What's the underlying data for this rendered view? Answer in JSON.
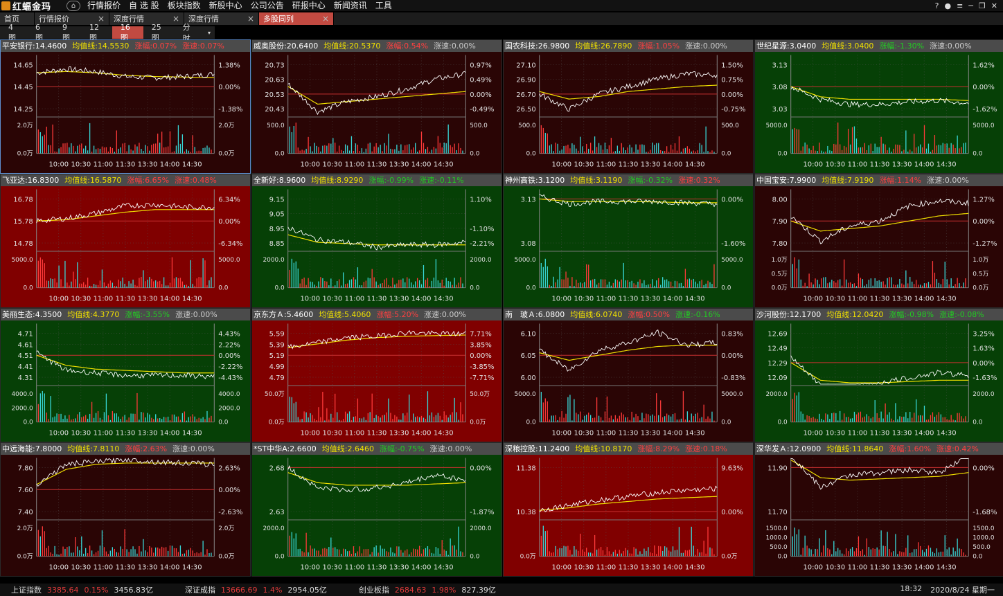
{
  "app": {
    "logo_text": "红蝠金玛"
  },
  "menu": [
    "行情报价",
    "自 选 股",
    "板块指数",
    "新股中心",
    "公司公告",
    "研报中心",
    "新闻资讯",
    "工具"
  ],
  "tabs": [
    {
      "label": "首页",
      "closable": false
    },
    {
      "label": "行情报价",
      "closable": true
    },
    {
      "label": "深度行情",
      "closable": true
    },
    {
      "label": "深度行情",
      "closable": true
    },
    {
      "label": "多股同列",
      "closable": true,
      "active": true
    }
  ],
  "grid_options": [
    "4图",
    "6图",
    "9图",
    "12图",
    "16图",
    "25图",
    "分时"
  ],
  "grid_active": "16图",
  "time_ticks": [
    "10:00",
    "10:30",
    "11:00",
    "11:30",
    "13:30",
    "14:00",
    "14:30"
  ],
  "colors": {
    "red_bg": "#7f0000",
    "dark_red_bg": "#3a0606",
    "green_bg": "#053a05",
    "up": "#ff4040",
    "down": "#22cc22",
    "ma": "#f0e000",
    "price": "#ffffff"
  },
  "stocks": [
    {
      "name": "平安银行",
      "price": "14.4600",
      "ma_label": "均值线:",
      "ma": "14.5530",
      "chg_label": "涨幅:",
      "chg": "0.07%",
      "spd_label": "涨速:",
      "spd": "0.07%",
      "bg": "dark",
      "y_left": [
        "14.65",
        "14.45",
        "14.25"
      ],
      "y_right": [
        "1.38%",
        "0.00%",
        "-1.38%"
      ],
      "vol_left": [
        "2.0万",
        "0.0万"
      ],
      "vol_right": [
        "2.0万",
        "0.0万"
      ],
      "trend": [
        0.55,
        0.7,
        0.6,
        0.4,
        0.35,
        0.4,
        0.5
      ],
      "ma_trend": [
        0.55,
        0.6,
        0.55,
        0.45,
        0.4,
        0.38,
        0.36
      ],
      "chg_color": "up",
      "spd_color": "up",
      "selected": true
    },
    {
      "name": "威奥股份",
      "price": "20.6400",
      "ma_label": "均值线:",
      "ma": "20.5370",
      "chg_label": "涨幅:",
      "chg": "0.54%",
      "spd_label": "涨速:",
      "spd": "0.00%",
      "bg": "dark",
      "y_left": [
        "20.73",
        "20.63",
        "20.53",
        "20.43"
      ],
      "y_right": [
        "0.97%",
        "0.49%",
        "0.00%",
        "-0.49%"
      ],
      "vol_left": [
        "500.0",
        "0.0"
      ],
      "vol_right": [
        "500.0",
        "0.0"
      ],
      "trend": [
        0.4,
        -0.7,
        -0.3,
        -0.1,
        0.2,
        0.6,
        0.8
      ],
      "ma_trend": [
        0.3,
        -0.4,
        -0.3,
        -0.2,
        -0.1,
        0.0,
        0.1
      ],
      "chg_color": "up",
      "spd_color": "neutral"
    },
    {
      "name": "国农科技",
      "price": "26.9800",
      "ma_label": "均值线:",
      "ma": "26.7890",
      "chg_label": "涨幅:",
      "chg": "1.05%",
      "spd_label": "涨速:",
      "spd": "0.00%",
      "bg": "dark",
      "y_left": [
        "27.10",
        "26.90",
        "26.70",
        "26.50"
      ],
      "y_right": [
        "1.50%",
        "0.75%",
        "0.00%",
        "-0.75%"
      ],
      "vol_left": [
        "500.0",
        "0.0"
      ],
      "vol_right": [
        "500.0",
        "0.0"
      ],
      "trend": [
        0.0,
        -0.6,
        0.0,
        0.3,
        0.6,
        0.8,
        0.75
      ],
      "ma_trend": [
        0.1,
        -0.2,
        -0.1,
        0.1,
        0.2,
        0.3,
        0.35
      ],
      "chg_color": "up",
      "spd_color": "neutral"
    },
    {
      "name": "世纪星源",
      "price": "3.0400",
      "ma_label": "均值线:",
      "ma": "3.0400",
      "chg_label": "涨幅:",
      "chg": "-1.30%",
      "spd_label": "涨速:",
      "spd": "0.00%",
      "bg": "green",
      "y_left": [
        "3.13",
        "3.08",
        "3.03"
      ],
      "y_right": [
        "1.62%",
        "0.00%",
        "-1.62%"
      ],
      "vol_left": [
        "5000.0",
        "0.0"
      ],
      "vol_right": [
        "5000.0",
        "0.0"
      ],
      "trend": [
        0.0,
        -0.5,
        -0.7,
        -0.7,
        -0.6,
        -0.55,
        -0.65
      ],
      "ma_trend": [
        0.0,
        -0.4,
        -0.5,
        -0.5,
        -0.5,
        -0.5,
        -0.55
      ],
      "chg_color": "down",
      "spd_color": "neutral"
    },
    {
      "name": "飞亚达",
      "price": "16.8300",
      "ma_label": "均值线:",
      "ma": "16.5870",
      "chg_label": "涨幅:",
      "chg": "6.65%",
      "spd_label": "涨速:",
      "spd": "0.48%",
      "bg": "red",
      "y_left": [
        "16.78",
        "15.78",
        "14.78"
      ],
      "y_right": [
        "6.34%",
        "0.00%",
        "-6.34%"
      ],
      "vol_left": [
        "5000.0",
        "0.0"
      ],
      "vol_right": [
        "5000.0",
        "0.0"
      ],
      "trend": [
        0.0,
        0.1,
        0.3,
        0.6,
        0.65,
        0.55,
        0.55
      ],
      "ma_trend": [
        0.0,
        0.05,
        0.2,
        0.35,
        0.45,
        0.45,
        0.45
      ],
      "chg_color": "up",
      "spd_color": "up"
    },
    {
      "name": "全新好",
      "price": "8.9600",
      "ma_label": "均值线:",
      "ma": "8.9290",
      "chg_label": "涨幅:",
      "chg": "-0.99%",
      "spd_label": "涨速:",
      "spd": "-0.11%",
      "bg": "green",
      "y_left": [
        "9.15",
        "9.05",
        "8.95",
        "8.85"
      ],
      "y_right": [
        "1.10%",
        "",
        "-1.10%",
        "-2.21%"
      ],
      "vol_left": [
        "2000.0",
        "0.0"
      ],
      "vol_right": [
        "2000.0",
        "0.0"
      ],
      "trend": [
        -0.3,
        -0.8,
        -0.9,
        -1.1,
        -1.0,
        -1.0,
        -0.9
      ],
      "ma_trend": [
        -0.6,
        -0.9,
        -0.95,
        -1.0,
        -1.0,
        -1.0,
        -1.0
      ],
      "chg_color": "down",
      "spd_color": "down"
    },
    {
      "name": "神州高铁",
      "price": "3.1200",
      "ma_label": "均值线:",
      "ma": "3.1190",
      "chg_label": "涨幅:",
      "chg": "-0.32%",
      "spd_label": "涨速:",
      "spd": "0.32%",
      "bg": "green",
      "y_left": [
        "3.13",
        "3.08"
      ],
      "y_right": [
        "0.00%",
        "-1.60%"
      ],
      "vol_left": [
        "5000.0",
        "0.0"
      ],
      "vol_right": [
        "5000.0",
        "0.0"
      ],
      "trend": [
        0.1,
        -0.2,
        -0.1,
        -0.1,
        -0.1,
        -0.15,
        -0.2
      ],
      "ma_trend": [
        0.0,
        -0.1,
        -0.1,
        -0.1,
        -0.12,
        -0.15,
        -0.15
      ],
      "chg_color": "down",
      "spd_color": "up"
    },
    {
      "name": "中国宝安",
      "price": "7.9900",
      "ma_label": "均值线:",
      "ma": "7.9190",
      "chg_label": "涨幅:",
      "chg": "1.14%",
      "spd_label": "涨速:",
      "spd": "0.00%",
      "bg": "dark",
      "y_left": [
        "8.00",
        "7.90",
        "7.80"
      ],
      "y_right": [
        "1.27%",
        "0.00%",
        "-1.27%"
      ],
      "vol_left": [
        "1.0万",
        "0.5万",
        "0.0万"
      ],
      "vol_right": [
        "1.0万",
        "0.5万",
        "0.0万"
      ],
      "trend": [
        0.2,
        -0.8,
        -0.2,
        0.0,
        0.6,
        0.8,
        0.7
      ],
      "ma_trend": [
        0.0,
        -0.4,
        -0.3,
        -0.2,
        0.0,
        0.2,
        0.3
      ],
      "chg_color": "up",
      "spd_color": "neutral"
    },
    {
      "name": "美丽生态",
      "price": "4.3500",
      "ma_label": "均值线:",
      "ma": "4.3770",
      "chg_label": "涨幅:",
      "chg": "-3.55%",
      "spd_label": "涨速:",
      "spd": "0.00%",
      "bg": "green",
      "y_left": [
        "4.71",
        "4.61",
        "4.51",
        "4.41",
        "4.31"
      ],
      "y_right": [
        "4.43%",
        "2.22%",
        "0.00%",
        "-2.22%",
        "-4.43%"
      ],
      "vol_left": [
        "4000.0",
        "2000.0",
        "0.0"
      ],
      "vol_right": [
        "4000.0",
        "2000.0",
        "0.0"
      ],
      "trend": [
        0.1,
        -0.6,
        -0.7,
        -0.8,
        -0.8,
        -0.8,
        -0.85
      ],
      "ma_trend": [
        0.0,
        -0.4,
        -0.55,
        -0.6,
        -0.65,
        -0.7,
        -0.7
      ],
      "chg_color": "down",
      "spd_color": "neutral"
    },
    {
      "name": "京东方Ａ",
      "price": "5.4600",
      "ma_label": "均值线:",
      "ma": "5.4060",
      "chg_label": "涨幅:",
      "chg": "5.20%",
      "spd_label": "涨速:",
      "spd": "0.00%",
      "bg": "red",
      "y_left": [
        "5.59",
        "5.39",
        "5.19",
        "4.99",
        "4.79"
      ],
      "y_right": [
        "7.71%",
        "3.85%",
        "0.00%",
        "-3.85%",
        "-7.71%"
      ],
      "vol_left": [
        "50.0万",
        "0.0万"
      ],
      "vol_right": [
        "50.0万",
        "0.0万"
      ],
      "trend": [
        0.3,
        0.5,
        0.7,
        0.75,
        0.9,
        0.85,
        0.85
      ],
      "ma_trend": [
        0.3,
        0.45,
        0.6,
        0.7,
        0.75,
        0.78,
        0.8
      ],
      "chg_color": "up",
      "spd_color": "neutral"
    },
    {
      "name": "南　玻Ａ",
      "price": "6.0800",
      "ma_label": "均值线:",
      "ma": "6.0740",
      "chg_label": "涨幅:",
      "chg": "0.50%",
      "spd_label": "涨速:",
      "spd": "-0.16%",
      "bg": "dark",
      "y_left": [
        "6.10",
        "6.05",
        "6.00"
      ],
      "y_right": [
        "0.83%",
        "0.00%",
        "-0.83%"
      ],
      "vol_left": [
        "5000.0",
        "0.0"
      ],
      "vol_right": [
        "5000.0",
        "0.0"
      ],
      "trend": [
        0.2,
        -0.6,
        0.2,
        0.5,
        0.9,
        0.4,
        0.5
      ],
      "ma_trend": [
        0.1,
        -0.2,
        0.0,
        0.2,
        0.35,
        0.4,
        0.4
      ],
      "chg_color": "up",
      "spd_color": "down"
    },
    {
      "name": "沙河股份",
      "price": "12.1700",
      "ma_label": "均值线:",
      "ma": "12.0420",
      "chg_label": "涨幅:",
      "chg": "-0.98%",
      "spd_label": "涨速:",
      "spd": "-0.08%",
      "bg": "green",
      "y_left": [
        "12.69",
        "12.49",
        "12.29",
        "12.09"
      ],
      "y_right": [
        "3.25%",
        "1.63%",
        "0.00%",
        "-1.63%"
      ],
      "vol_left": [
        "2000.0",
        "0.0"
      ],
      "vol_right": [
        "2000.0",
        "0.0"
      ],
      "trend": [
        0.2,
        -0.9,
        -1.0,
        -0.8,
        -0.6,
        -0.4,
        -0.5
      ],
      "ma_trend": [
        0.0,
        -0.7,
        -0.8,
        -0.8,
        -0.75,
        -0.7,
        -0.7
      ],
      "chg_color": "down",
      "spd_color": "down"
    },
    {
      "name": "中远海能",
      "price": "7.8000",
      "ma_label": "均值线:",
      "ma": "7.8110",
      "chg_label": "涨幅:",
      "chg": "2.63%",
      "spd_label": "涨速:",
      "spd": "0.00%",
      "bg": "dark",
      "y_left": [
        "7.80",
        "7.60",
        "7.40"
      ],
      "y_right": [
        "2.63%",
        "0.00%",
        "-2.63%"
      ],
      "vol_left": [
        "2.0万",
        "0.0万"
      ],
      "vol_right": [
        "2.0万",
        "0.0万"
      ],
      "trend": [
        0.2,
        1.0,
        1.1,
        1.2,
        1.1,
        1.05,
        1.0
      ],
      "ma_trend": [
        0.2,
        0.8,
        1.0,
        1.05,
        1.05,
        1.05,
        1.05
      ],
      "chg_color": "up",
      "spd_color": "neutral"
    },
    {
      "name": "*ST中华A",
      "price": "2.6600",
      "ma_label": "均值线:",
      "ma": "2.6460",
      "chg_label": "涨幅:",
      "chg": "-0.75%",
      "spd_label": "涨速:",
      "spd": "0.00%",
      "bg": "green",
      "y_left": [
        "2.68",
        "2.63"
      ],
      "y_right": [
        "0.00%",
        "-1.87%"
      ],
      "vol_left": [
        "2000.0",
        "0.0"
      ],
      "vol_right": [
        "2000.0",
        "0.0"
      ],
      "trend": [
        0.0,
        -0.8,
        -0.9,
        -0.8,
        -0.6,
        -0.3,
        -0.5
      ],
      "ma_trend": [
        -0.2,
        -0.6,
        -0.7,
        -0.7,
        -0.7,
        -0.65,
        -0.6
      ],
      "chg_color": "down",
      "spd_color": "neutral"
    },
    {
      "name": "深粮控股",
      "price": "11.2400",
      "ma_label": "均值线:",
      "ma": "10.8170",
      "chg_label": "涨幅:",
      "chg": "8.29%",
      "spd_label": "涨速:",
      "spd": "0.18%",
      "bg": "red",
      "y_left": [
        "11.38",
        "10.38"
      ],
      "y_right": [
        "9.63%",
        "0.00%"
      ],
      "vol_left": [
        "0.0万"
      ],
      "vol_right": [
        "0.0万"
      ],
      "trend": [
        0.05,
        0.25,
        0.45,
        0.6,
        0.75,
        0.85,
        0.9
      ],
      "ma_trend": [
        0.05,
        0.15,
        0.3,
        0.4,
        0.5,
        0.55,
        0.6
      ],
      "chg_color": "up",
      "spd_color": "up"
    },
    {
      "name": "深华发Ａ",
      "price": "12.0900",
      "ma_label": "均值线:",
      "ma": "11.8640",
      "chg_label": "涨幅:",
      "chg": "1.60%",
      "spd_label": "涨速:",
      "spd": "0.42%",
      "bg": "dark",
      "y_left": [
        "11.90",
        "11.70"
      ],
      "y_right": [
        "0.00%",
        "-1.68%"
      ],
      "vol_left": [
        "1500.0",
        "1000.0",
        "500.0",
        "0.0"
      ],
      "vol_right": [
        "1500.0",
        "1000.0",
        "500.0",
        "0.0"
      ],
      "trend": [
        0.5,
        -0.8,
        -0.3,
        -0.2,
        -0.1,
        -0.2,
        0.5
      ],
      "ma_trend": [
        0.3,
        -0.4,
        -0.5,
        -0.45,
        -0.4,
        -0.35,
        -0.2
      ],
      "chg_color": "up",
      "spd_color": "up"
    }
  ],
  "status": {
    "indices": [
      {
        "name": "上证指数",
        "value": "3385.64",
        "pct": "0.15%",
        "amount": "3456.83亿"
      },
      {
        "name": "深证成指",
        "value": "13666.69",
        "pct": "1.4%",
        "amount": "2954.05亿"
      },
      {
        "name": "创业板指",
        "value": "2684.63",
        "pct": "1.98%",
        "amount": "827.39亿"
      }
    ],
    "time": "18:32",
    "date": "2020/8/24 星期一"
  }
}
